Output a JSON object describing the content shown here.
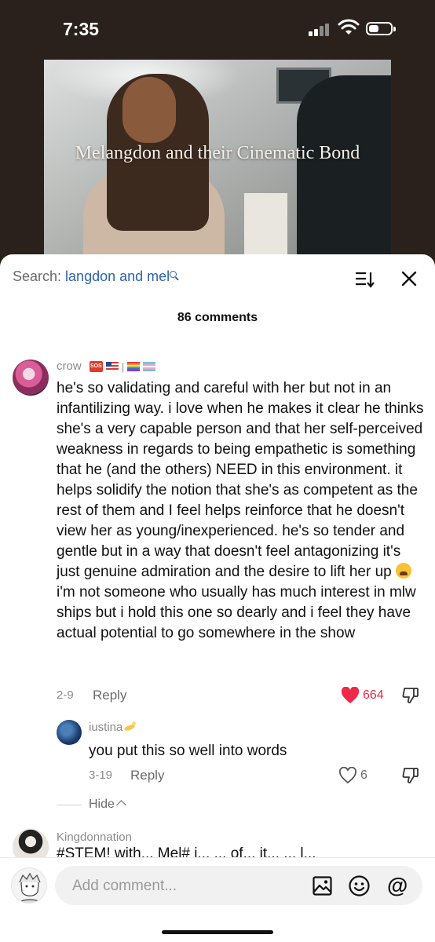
{
  "status_bar": {
    "time": "7:35"
  },
  "video": {
    "caption": "Melangdon and their Cinematic Bond"
  },
  "search": {
    "prefix": "Search: ",
    "query": "langdon and mel"
  },
  "comments_header": {
    "count_text": "86 comments"
  },
  "comments": [
    {
      "username": "crow",
      "badge_separator": "|",
      "text_before_emoji": "he's so validating and careful with her but not in an infantilizing way. i love when he makes it clear he thinks she's a very capable person and that her self-perceived weakness in regards to being empathetic is something that he (and the others) NEED in this environment. it helps solidify the notion that she's as competent as the rest of them and I feel helps reinforce that he doesn't view her as young/inexperienced. he's so tender and gentle but in a way that doesn't feel antagonizing it's just genuine admiration and the desire to lift her up",
      "text_after_emoji": " i'm not someone who usually has much interest in mlw ships but i hold this one so dearly and i feel they have actual potential to go somewhere in the show",
      "date": "2-9",
      "reply_label": "Reply",
      "likes": "664",
      "liked": true
    },
    {
      "username": "iustina",
      "text": "you put this so well into words",
      "date": "3-19",
      "reply_label": "Reply",
      "likes": "6",
      "liked": false
    },
    {
      "username": "Kingdonnation",
      "text": "#STEM! with... Mel# i... ... of... it... ... l..."
    }
  ],
  "replies_toggle": {
    "label": "Hide"
  },
  "composer": {
    "placeholder": "Add comment..."
  },
  "colors": {
    "like_red": "#f0284a",
    "link_blue": "#2f62a8",
    "muted_gray": "#8a8a8a"
  },
  "icons": [
    "search-icon",
    "sort-icon",
    "close-icon",
    "heart-filled-icon",
    "heart-outline-icon",
    "dislike-icon",
    "chevron-up-icon",
    "image-icon",
    "emoji-icon",
    "mention-icon"
  ]
}
